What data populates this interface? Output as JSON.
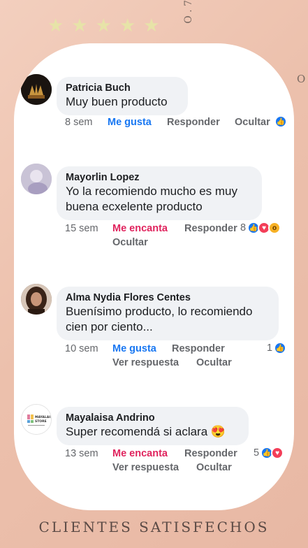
{
  "decor": {
    "stars": [
      "★",
      "★",
      "★",
      "★",
      "★"
    ],
    "side_text_top": "O . 7",
    "side_text_right": "O"
  },
  "comments": [
    {
      "author": "Patricia Buch",
      "text": "Muy buen producto",
      "time": "8 sem",
      "reaction_label": "Me gusta",
      "reply_label": "Responder",
      "hide_label": "Ocultar",
      "reaction_count": ""
    },
    {
      "author": "Mayorlin Lopez",
      "text": "Yo la recomiendo mucho es muy buena ecxelente producto",
      "time": "15 sem",
      "reaction_label": "Me encanta",
      "reply_label": "Responder",
      "hide_label": "Ocultar",
      "reaction_count": "8"
    },
    {
      "author": "Alma Nydia Flores Centes",
      "text": "Buenísimo producto, lo recomiendo cien por ciento...",
      "time": "10 sem",
      "reaction_label": "Me gusta",
      "reply_label": "Responder",
      "view_reply_label": "Ver respuesta",
      "hide_label": "Ocultar",
      "reaction_count": "1"
    },
    {
      "author": "Mayalaisa Andrino",
      "text": "Super recomendá si aclara 😍",
      "time": "13 sem",
      "reaction_label": "Me encanta",
      "reply_label": "Responder",
      "view_reply_label": "Ver respuesta",
      "hide_label": "Ocultar",
      "reaction_count": "5",
      "avatar_logo_text": "MAYALAISA STORE"
    }
  ],
  "footer": {
    "title": "CLIENTES SATISFECHOS"
  },
  "colors": {
    "like": "#1877f2",
    "love": "#e0245e",
    "bubble": "#f0f2f5",
    "background": "#ecc0ac"
  }
}
